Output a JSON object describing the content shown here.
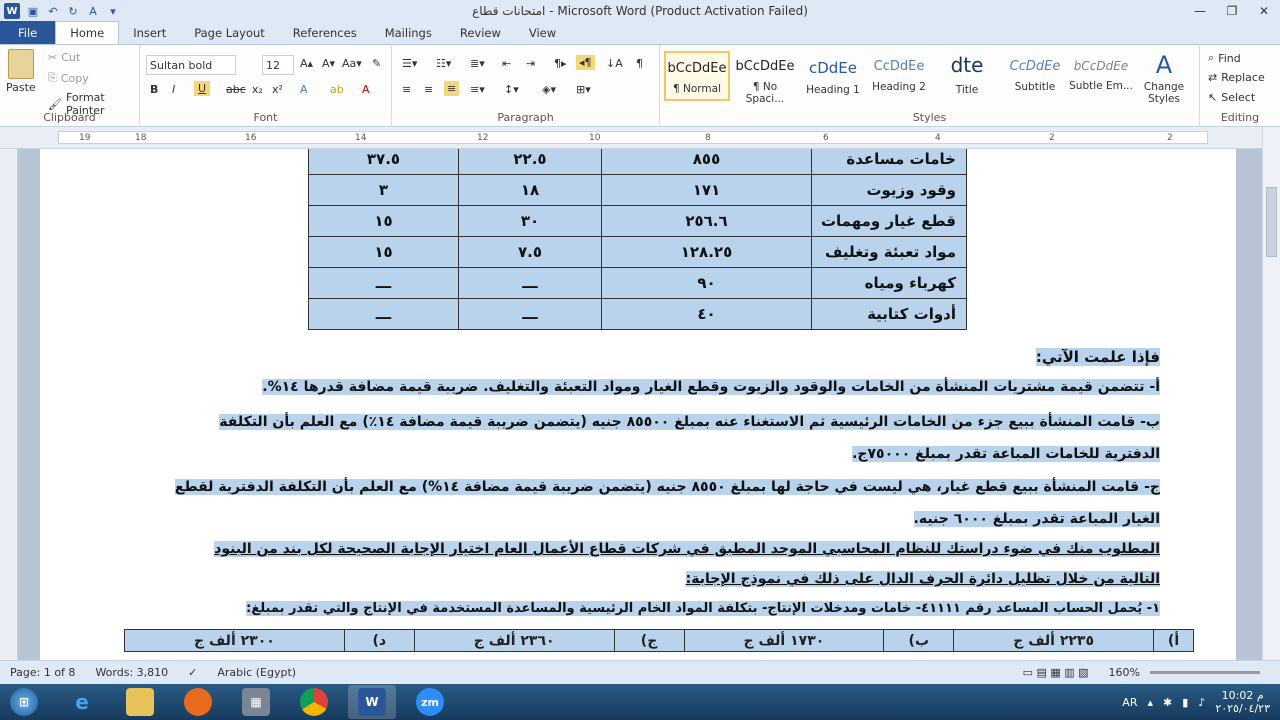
{
  "window": {
    "title": "امتحانات قطاع  -  Microsoft Word (Product Activation Failed)",
    "controls": [
      "—",
      "❐",
      "✕"
    ]
  },
  "tabs": [
    "File",
    "Home",
    "Insert",
    "Page Layout",
    "References",
    "Mailings",
    "Review",
    "View"
  ],
  "ribbon": {
    "clipboard": {
      "paste": "Paste",
      "cut": "Cut",
      "copy": "Copy",
      "format_painter": "Format Painter",
      "label": "Clipboard"
    },
    "font": {
      "name": "Sultan bold",
      "size": "12",
      "label": "Font"
    },
    "paragraph": {
      "label": "Paragraph"
    },
    "styles": {
      "label": "Styles",
      "items": [
        {
          "preview": "bCcDdEe",
          "name": "¶ Normal"
        },
        {
          "preview": "bCcDdEe",
          "name": "¶ No Spaci..."
        },
        {
          "preview": "cDdEe",
          "name": "Heading 1"
        },
        {
          "preview": "CcDdEe",
          "name": "Heading 2"
        },
        {
          "preview": "dte",
          "name": "Title"
        },
        {
          "preview": "CcDdEe",
          "name": "Subtitle"
        },
        {
          "preview": "bCcDdEe",
          "name": "Subtle Em..."
        }
      ],
      "change_styles": "Change Styles"
    },
    "editing": {
      "find": "Find",
      "replace": "Replace",
      "select": "Select",
      "label": "Editing"
    }
  },
  "ruler": {
    "numbers": [
      "19",
      "18",
      "16",
      "14",
      "12",
      "10",
      "8",
      "6",
      "4",
      "2",
      "2"
    ]
  },
  "document": {
    "table1": [
      [
        "خامات مساعدة",
        "٨٥٥",
        "٢٢.٥",
        "٣٧.٥"
      ],
      [
        "وقود وزيوت",
        "١٧١",
        "١٨",
        "٣"
      ],
      [
        "قطع غيار ومهمات",
        "٢٥٦.٦",
        "٣٠",
        "١٥"
      ],
      [
        "مواد تعبئة وتغليف",
        "١٢٨.٢٥",
        "٧.٥",
        "١٥"
      ],
      [
        "كهرباء ومياه",
        "٩٠",
        "ـــ",
        "ـــ"
      ],
      [
        "أدوات كتابية",
        "٤٠",
        "ـــ",
        "ـــ"
      ]
    ],
    "lines": [
      "فإذا علمت الآتي:",
      "أ- تتضمن قيمة مشتريات المنشأة من الخامات والوقود والزيوت وقطع الغيار ومواد التعبئة والتغليف. ضريبة قيمة مضافة قدرها ١٤%.",
      "ب- قامت المنشأة ببيع جزء من الخامات الرئيسية ثم الاستغناء عنه بمبلغ ٨٥٥٠٠ جنيه (يتضمن ضريبة قيمة مضافة ١٤٪) مع العلم بأن التكلفة",
      "الدفترية للخامات المباعة تقدر بمبلغ ٧٥٠٠٠ج.",
      "ج- قامت المنشأة ببيع قطع غيار، هي ليست في حاجة لها بمبلغ ٨٥٥٠ جنيه (يتضمن ضريبة قيمة مضافة ١٤%) مع العلم بأن التكلفة الدفترية لقطع",
      "الغيار المباعة تقدر بمبلغ ٦٠٠٠ جنيه.",
      "المطلوب منك في ضوء دراستك للنظام المحاسبي الموحد المطبق في شركات قطاع الأعمال العام اختيار الإجابة الصحيحة لكل بند من البنود",
      "التالية من خلال تظليل دائرة الحرف الدال على ذلك في نموذج الإجابة:",
      "١- يُحمل الحساب المساعد رقم ٤١١١١- خامات ومدخلات الإنتاج- بتكلفة المواد الخام الرئيسية والمساعدة المستخدمة في الإنتاج والتي تقدر بمبلغ:"
    ],
    "table2": [
      "أ)",
      "٢٢٣٥ ألف ج",
      "ب)",
      "١٧٣٠ ألف ج",
      "ج)",
      "٢٣٦٠ ألف ج",
      "د)",
      "٢٣٠٠ ألف ج"
    ]
  },
  "status": {
    "page": "Page: 1 of 8",
    "words": "Words: 3,810",
    "language": "Arabic (Egypt)",
    "zoom": "160%"
  },
  "tray": {
    "lang": "AR",
    "time": "10:02 م",
    "date": "٢٠٢٥/٠٤/٢٣"
  }
}
